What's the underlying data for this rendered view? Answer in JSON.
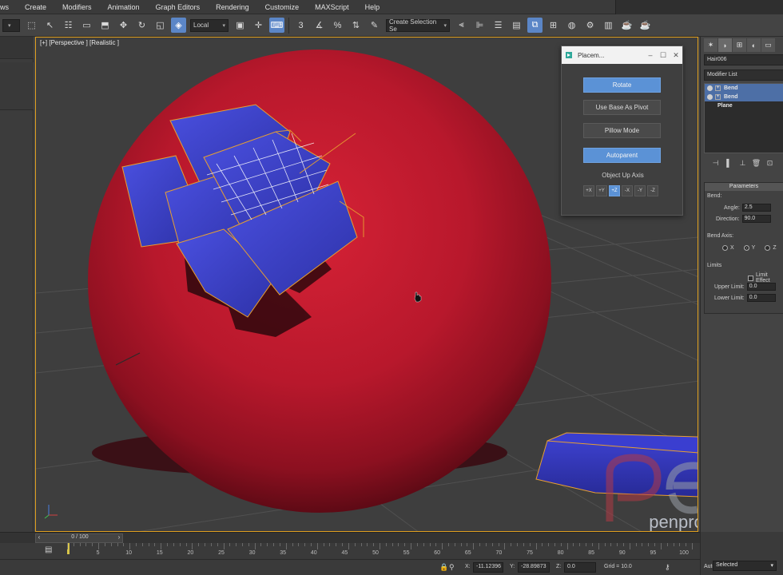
{
  "menu": [
    "ws",
    "Create",
    "Modifiers",
    "Animation",
    "Graph Editors",
    "Rendering",
    "Customize",
    "MAXScript",
    "Help"
  ],
  "toolbar": {
    "coord_system": "Local",
    "named_selection": "Create Selection Se"
  },
  "viewport": {
    "label": "[+] [Perspective ] [Realistic ]"
  },
  "dialog": {
    "title": "Placem...",
    "rotate_label": "Rotate",
    "use_base_label": "Use Base As Pivot",
    "pillow_label": "Pillow Mode",
    "autoparent_label": "Autoparent",
    "up_axis_label": "Object Up Axis",
    "axes": [
      "+X",
      "+Y",
      "+Z",
      "-X",
      "-Y",
      "-Z"
    ],
    "selected_axis": "+Z"
  },
  "command_panel": {
    "object_name": "Hair006",
    "modifier_list": "Modifier List",
    "stack": [
      "Bend",
      "Bend",
      "Plane"
    ],
    "params_header": "Parameters",
    "bend_group": "Bend:",
    "angle_label": "Angle:",
    "angle_value": "2.5",
    "direction_label": "Direction:",
    "direction_value": "90.0",
    "axis_group": "Bend Axis:",
    "axis_x": "X",
    "axis_y": "Y",
    "axis_z": "Z",
    "limits_group": "Limits",
    "limit_effect": "Limit Effect",
    "upper_label": "Upper Limit:",
    "upper_value": "0.0",
    "lower_label": "Lower Limit:",
    "lower_value": "0.0"
  },
  "timeline": {
    "frame_label": "0 / 100",
    "frame_fraction": 0,
    "ticks": [
      "5",
      "10",
      "15",
      "20",
      "25",
      "30",
      "35",
      "40",
      "45",
      "50",
      "55",
      "60",
      "65",
      "70",
      "75",
      "80",
      "85",
      "90",
      "95",
      "100"
    ]
  },
  "status": {
    "x_label": "X:",
    "x_value": "-11.12396",
    "y_label": "Y:",
    "y_value": "-28.89873",
    "z_label": "Z:",
    "z_value": "0.0",
    "grid": "Grid = 10.0",
    "auto_key": "Auto Key",
    "selected": "Selected"
  },
  "watermark": "penprod",
  "colors": {
    "sphere": "#b0182c",
    "planes": "#3b3fc8",
    "selection": "#e8a030",
    "accent_blue": "#5b92d6"
  }
}
